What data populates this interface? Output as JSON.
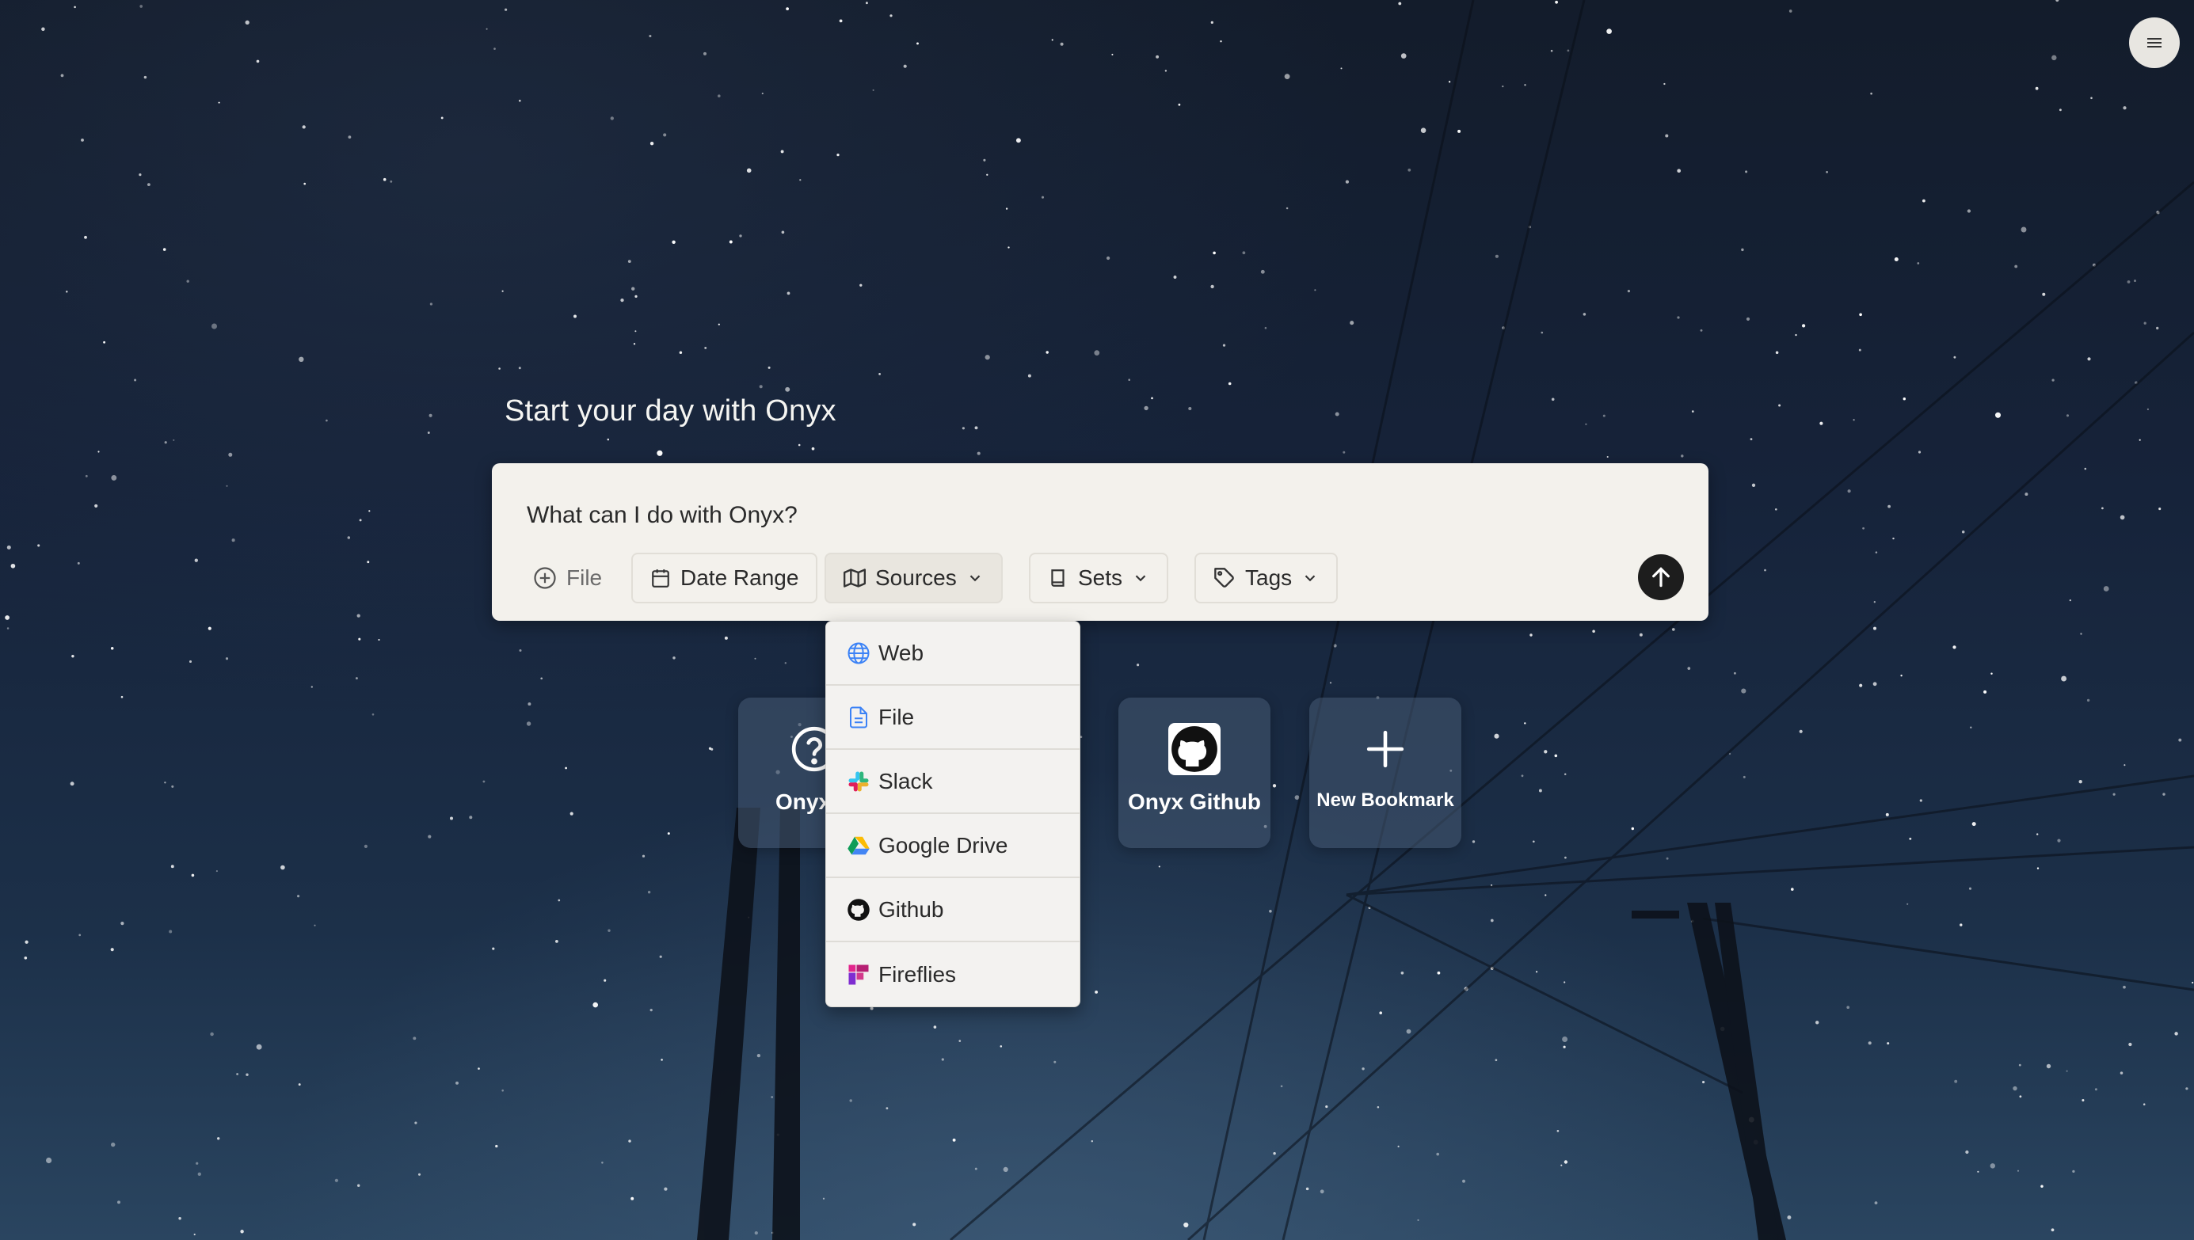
{
  "headline": "Start your day with Onyx",
  "search": {
    "placeholder": "What can I do with Onyx?"
  },
  "filters": {
    "file_label": "File",
    "date_range_label": "Date Range",
    "sources_label": "Sources",
    "sets_label": "Sets",
    "tags_label": "Tags"
  },
  "sources_menu": {
    "items": [
      {
        "label": "Web",
        "icon": "globe-icon"
      },
      {
        "label": "File",
        "icon": "file-icon"
      },
      {
        "label": "Slack",
        "icon": "slack-icon"
      },
      {
        "label": "Google Drive",
        "icon": "google-drive-icon"
      },
      {
        "label": "Github",
        "icon": "github-icon"
      },
      {
        "label": "Fireflies",
        "icon": "fireflies-icon"
      }
    ]
  },
  "bookmarks": [
    {
      "label": "Onyx C",
      "icon": "question-circle-icon"
    },
    {
      "label": "Onyx Github",
      "icon": "github-icon"
    },
    {
      "label": "New Bookmark",
      "icon": "plus-icon"
    }
  ],
  "colors": {
    "card_bg": "#f3f1ec",
    "send_button": "#1d1d1d",
    "headline_text": "#f5f5f2"
  }
}
